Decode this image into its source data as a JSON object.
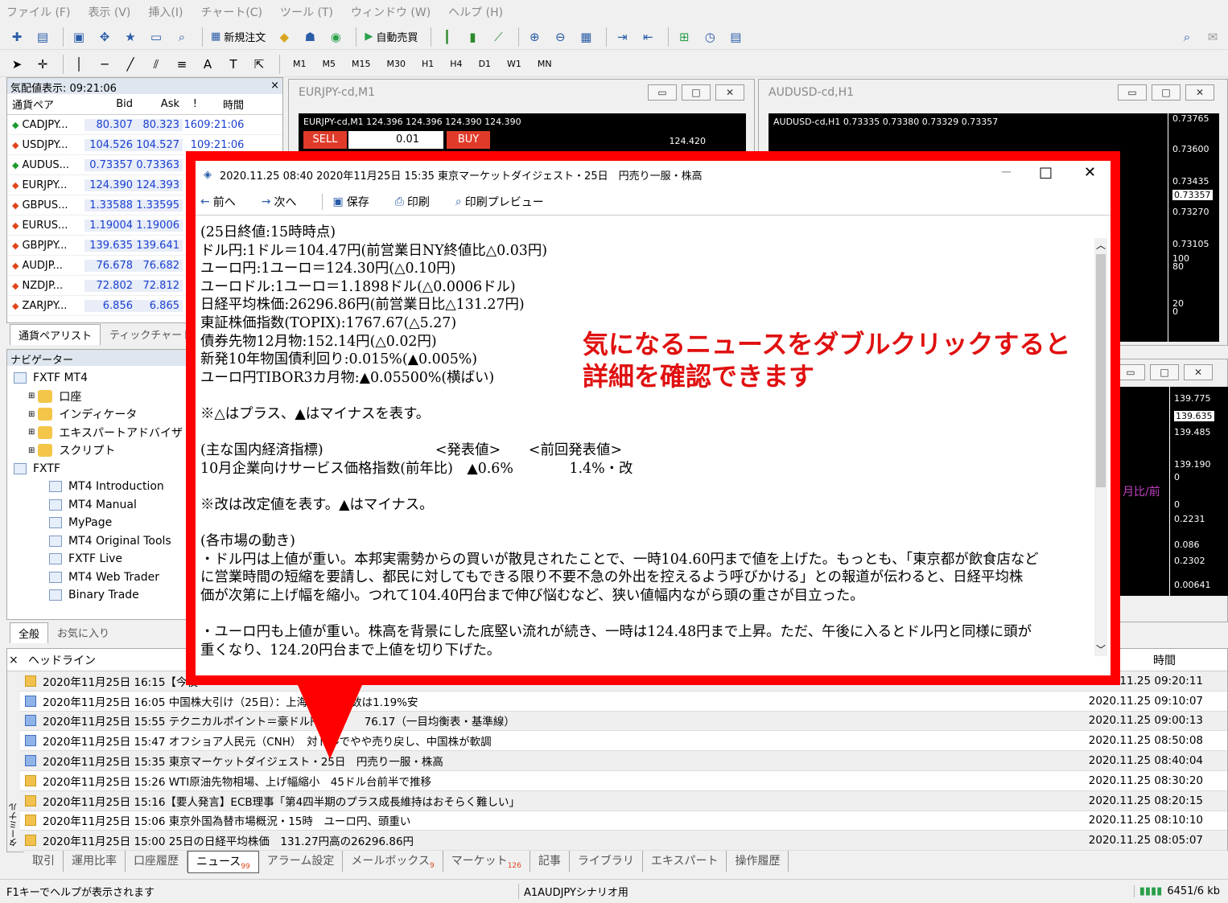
{
  "menu": [
    "ファイル (F)",
    "表示 (V)",
    "挿入(I)",
    "チャート(C)",
    "ツール (T)",
    "ウィンドウ (W)",
    "ヘルプ (H)"
  ],
  "toolbar": {
    "new_order": "新規注文",
    "auto_trade": "自動売買",
    "timeframes": [
      "M1",
      "M5",
      "M15",
      "M30",
      "H1",
      "H4",
      "D1",
      "W1",
      "MN"
    ]
  },
  "market_watch": {
    "title": "気配値表示: 09:21:06",
    "headers": {
      "pair": "通貨ペア",
      "bid": "Bid",
      "ask": "Ask",
      "spread": "!",
      "time": "時間"
    },
    "rows": [
      {
        "pair": "CADJPY...",
        "bid": "80.307",
        "ask": "80.323",
        "spread": "16",
        "time": "09:21:06",
        "dir": "up"
      },
      {
        "pair": "USDJPY...",
        "bid": "104.526",
        "ask": "104.527",
        "spread": "1",
        "time": "09:21:06",
        "dir": "down"
      },
      {
        "pair": "AUDUS...",
        "bid": "0.73357",
        "ask": "0.73363",
        "spread": "",
        "time": "",
        "dir": "up"
      },
      {
        "pair": "EURJPY...",
        "bid": "124.390",
        "ask": "124.393",
        "spread": "",
        "time": "",
        "dir": "down"
      },
      {
        "pair": "GBPUS...",
        "bid": "1.33588",
        "ask": "1.33595",
        "spread": "",
        "time": "",
        "dir": "down"
      },
      {
        "pair": "EURUS...",
        "bid": "1.19004",
        "ask": "1.19006",
        "spread": "",
        "time": "",
        "dir": "down"
      },
      {
        "pair": "GBPJPY...",
        "bid": "139.635",
        "ask": "139.641",
        "spread": "",
        "time": "",
        "dir": "down"
      },
      {
        "pair": "AUDJP...",
        "bid": "76.678",
        "ask": "76.682",
        "spread": "",
        "time": "",
        "dir": "down"
      },
      {
        "pair": "NZDJP...",
        "bid": "72.802",
        "ask": "72.812",
        "spread": "",
        "time": "",
        "dir": "down"
      },
      {
        "pair": "ZARJPY...",
        "bid": "6.856",
        "ask": "6.865",
        "spread": "",
        "time": "",
        "dir": "down"
      }
    ],
    "tabs": [
      "通貨ペアリスト",
      "ティックチャート"
    ]
  },
  "navigator": {
    "title": "ナビゲーター",
    "items": [
      {
        "label": "FXTF MT4",
        "level": 0,
        "icon": "computer"
      },
      {
        "label": "口座",
        "level": 1,
        "icon": "folder"
      },
      {
        "label": "インディケータ",
        "level": 1,
        "icon": "folder"
      },
      {
        "label": "エキスパートアドバイザ",
        "level": 1,
        "icon": "folder"
      },
      {
        "label": "スクリプト",
        "level": 1,
        "icon": "folder"
      },
      {
        "label": "FXTF",
        "level": 0,
        "icon": "computer"
      },
      {
        "label": "MT4 Introduction",
        "level": 2,
        "icon": "page"
      },
      {
        "label": "MT4 Manual",
        "level": 2,
        "icon": "page"
      },
      {
        "label": "MyPage",
        "level": 2,
        "icon": "page"
      },
      {
        "label": "MT4 Original Tools",
        "level": 2,
        "icon": "page"
      },
      {
        "label": "FXTF Live",
        "level": 2,
        "icon": "page"
      },
      {
        "label": "MT4 Web Trader",
        "level": 2,
        "icon": "page"
      },
      {
        "label": "Binary Trade",
        "level": 2,
        "icon": "page"
      }
    ],
    "tabs": [
      "全般",
      "お気に入り"
    ]
  },
  "charts": {
    "eurjpy": {
      "title": "EURJPY-cd,M1",
      "info": "EURJPY-cd,M1  124.396 124.396 124.390 124.390",
      "sell": "SELL",
      "buy": "BUY",
      "lot": "0.01",
      "price": "124.420"
    },
    "audusd": {
      "title": "AUDUSD-cd,H1",
      "info": "AUDUSD-cd,H1  0.73335 0.73380 0.73329 0.73357",
      "prices": [
        "0.73765",
        "0.73600",
        "0.73435",
        "0.73357",
        "0.73270",
        "0.73105",
        "100",
        "80",
        "20",
        "0"
      ]
    },
    "gbpjpy": {
      "prices": [
        "139.775",
        "139.635",
        "139.485",
        "139.190",
        "0",
        "0",
        "0.2231",
        "0.086",
        "0.2302",
        "0.00641"
      ],
      "label": "月比/前"
    }
  },
  "popup": {
    "title": "2020.11.25 08:40 2020年11月25日 15:35 東京マーケットダイジェスト・25日　円売り一服・株高",
    "toolbar": {
      "prev": "前へ",
      "next": "次へ",
      "save": "保存",
      "print": "印刷",
      "preview": "印刷プレビュー"
    },
    "body": "(25日終値:15時時点)\nドル円:1ドル＝104.47円(前営業日NY終値比△0.03円)\nユーロ円:1ユーロ＝124.30円(△0.10円)\nユーロドル:1ユーロ＝1.1898ドル(△0.0006ドル)\n日経平均株価:26296.86円(前営業日比△131.27円)\n東証株価指数(TOPIX):1767.67(△5.27)\n債券先物12月物:152.14円(△0.02円)\n新発10年物国債利回り:0.015%(▲0.005%)\nユーロ円TIBOR3カ月物:▲0.05500%(横ばい)\n\n※△はプラス、▲はマイナスを表す。\n\n(主な国内経済指標)　　　　　　　　<発表値>　　<前回発表値>\n10月企業向けサービス価格指数(前年比)　▲0.6%　　　　1.4%・改\n\n※改は改定値を表す。▲はマイナス。\n\n(各市場の動き)\n・ドル円は上値が重い。本邦実需勢からの買いが散見されたことで、一時104.60円まで値を上げた。もっとも、「東京都が飲食店など\nに営業時間の短縮を要請し、都民に対してもできる限り不要不急の外出を控えるよう呼びかける」との報道が伝わると、日経平均株\n価が次第に上げ幅を縮小。つれて104.40円台まで伸び悩むなど、狭い値幅内ながら頭の重さが目立った。\n\n・ユーロ円も上値が重い。株高を背景にした底堅い流れが続き、一時は124.48円まで上昇。ただ、午後に入るとドル円と同様に頭が\n重くなり、124.20円台まで上値を切り下げた。"
  },
  "annotation": [
    "気になるニュースをダブルクリックすると",
    "詳細を確認できます"
  ],
  "terminal": {
    "headers": {
      "headline": "ヘッドライン",
      "time": "時間"
    },
    "rows": [
      {
        "text": "2020年11月25日 16:15【今夜",
        "time": "2020.11.25 09:20:11",
        "icon": "y"
      },
      {
        "text": "2020年11月25日 16:05 中国株大引け（25日）：上海　　　指数は1.19%安",
        "time": "2020.11.25 09:10:07",
        "icon": "b"
      },
      {
        "text": "2020年11月25日 15:55 テクニカルポイント＝豪ドル円サポ　　76.17（一目均衡表・基準線）",
        "time": "2020.11.25 09:00:13",
        "icon": "b"
      },
      {
        "text": "2020年11月25日 15:47 オフショア人民元（CNH）　対ドルでやや売り戻し、中国株が軟調",
        "time": "2020.11.25 08:50:08",
        "icon": "b"
      },
      {
        "text": "2020年11月25日 15:35 東京マーケットダイジェスト・25日　円売り一服・株高",
        "time": "2020.11.25 08:40:04",
        "icon": "b"
      },
      {
        "text": "2020年11月25日 15:26 WTI原油先物相場、上げ幅縮小　45ドル台前半で推移",
        "time": "2020.11.25 08:30:20",
        "icon": "y"
      },
      {
        "text": "2020年11月25日 15:16【要人発言】ECB理事「第4四半期のプラス成長維持はおそらく難しい」",
        "time": "2020.11.25 08:20:15",
        "icon": "y"
      },
      {
        "text": "2020年11月25日 15:06 東京外国為替市場概況・15時　ユーロ円、頭重い",
        "time": "2020.11.25 08:10:10",
        "icon": "y"
      },
      {
        "text": "2020年11月25日 15:00 25日の日経平均株価　131.27円高の26296.86円",
        "time": "2020.11.25 08:05:07",
        "icon": "y"
      }
    ],
    "tabs": [
      {
        "label": "取引",
        "count": ""
      },
      {
        "label": "運用比率",
        "count": ""
      },
      {
        "label": "口座履歴",
        "count": ""
      },
      {
        "label": "ニュース",
        "count": "99"
      },
      {
        "label": "アラーム設定",
        "count": ""
      },
      {
        "label": "メールボックス",
        "count": "9"
      },
      {
        "label": "マーケット",
        "count": "126"
      },
      {
        "label": "記事",
        "count": ""
      },
      {
        "label": "ライブラリ",
        "count": ""
      },
      {
        "label": "エキスパート",
        "count": ""
      },
      {
        "label": "操作履歴",
        "count": ""
      }
    ],
    "side_label": "ターミナル"
  },
  "status": {
    "help": "F1キーでヘルプが表示されます",
    "profile": "A1AUDJPYシナリオ用",
    "traffic": "6451/6 kb"
  }
}
